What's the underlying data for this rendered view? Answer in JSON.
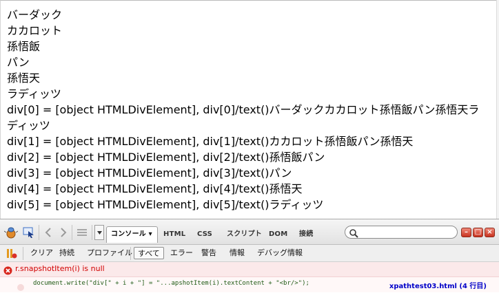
{
  "page": {
    "lines": [
      "バーダック",
      "カカロット",
      "孫悟飯",
      "パン",
      "孫悟天",
      "ラディッツ",
      "div[0] = [object HTMLDivElement], div[0]/text()バーダックカカロット孫悟飯パン孫悟天ラ",
      "ディッツ",
      "div[1] = [object HTMLDivElement], div[1]/text()カカロット孫悟飯パン孫悟天",
      "div[2] = [object HTMLDivElement], div[2]/text()孫悟飯パン",
      "div[3] = [object HTMLDivElement], div[3]/text()パン",
      "div[4] = [object HTMLDivElement], div[4]/text()孫悟天",
      "div[5] = [object HTMLDivElement], div[5]/text()ラディッツ"
    ]
  },
  "firebug": {
    "tabs": {
      "console": "コンソール ▾",
      "html": "HTML",
      "css": "CSS",
      "script": "スクリプト",
      "dom": "DOM",
      "net": "接続"
    },
    "search_placeholder": "",
    "subbar": {
      "clear": "クリア",
      "persist": "持続",
      "profile": "プロファイル",
      "all": "すべて",
      "errors": "エラー",
      "warnings": "警告",
      "info": "情報",
      "debug": "デバッグ情報"
    },
    "error": {
      "message": "r.snapshotItem(i) is null",
      "code": "document.write(\"div[\" + i + \"] = \"...apshotItem(i).textContent + \"<br/>\");",
      "source": "xpathtest03.html (4 行目)"
    },
    "icons": [
      "firebug-icon",
      "inspect-icon",
      "back-icon",
      "forward-icon",
      "list-icon",
      "menu-icon",
      "search-icon",
      "minimize-icon",
      "restore-icon",
      "close-icon",
      "pause-icon",
      "error-icon",
      "breakpoint-icon"
    ],
    "colors": {
      "error_text": "#d10000",
      "error_bg": "#fbe9ea",
      "code_text": "#1e5a14",
      "link": "#0000c8"
    }
  }
}
